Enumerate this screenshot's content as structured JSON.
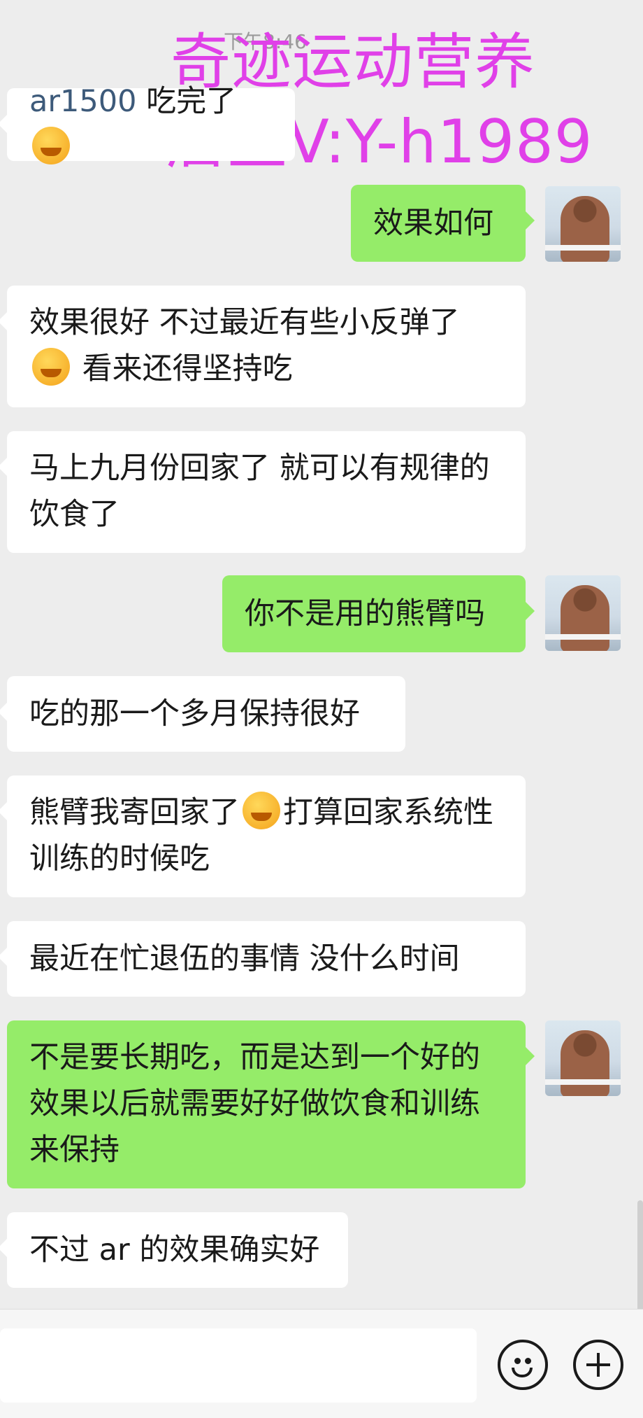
{
  "status": {
    "time": "下午8:46"
  },
  "watermark": {
    "line1": "奇迹运动营养",
    "line2": "店主V:Y-h1989"
  },
  "messages": [
    {
      "dir": "in",
      "tag": "ar1500",
      "text": "吃完了",
      "emoji": "smiling-face-emoji"
    },
    {
      "dir": "out",
      "text": "效果如何"
    },
    {
      "dir": "in",
      "text_a": "效果很好 不过最近有些小反弹了",
      "emoji": "crying-laughing-emoji",
      "text_b": "看来还得坚持吃"
    },
    {
      "dir": "in",
      "text": "马上九月份回家了  就可以有规律的饮食了"
    },
    {
      "dir": "out",
      "text": "你不是用的熊臂吗"
    },
    {
      "dir": "in",
      "text": "吃的那一个多月保持很好"
    },
    {
      "dir": "in",
      "text_a": "熊臂我寄回家了",
      "emoji": "crying-laughing-emoji",
      "text_b": "打算回家系统性训练的时候吃"
    },
    {
      "dir": "in",
      "text": "最近在忙退伍的事情 没什么时间"
    },
    {
      "dir": "out",
      "text": "不是要长期吃，而是达到一个好的效果以后就需要好好做饮食和训练来保持"
    },
    {
      "dir": "in",
      "text": "不过 ar 的效果确实好"
    }
  ],
  "input": {
    "value": "",
    "placeholder": ""
  },
  "icons": {
    "emoji_button": "emoji-icon",
    "plus_button": "plus-icon"
  }
}
